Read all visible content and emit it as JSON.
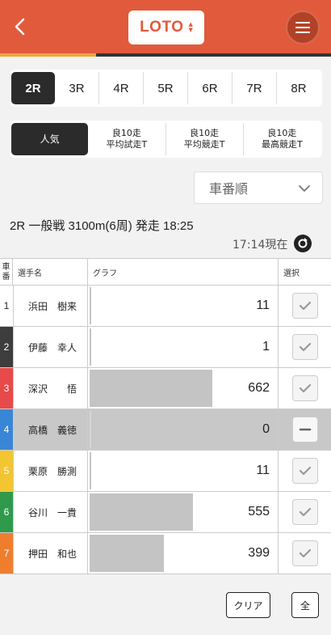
{
  "header": {
    "logo_label": "LOTO"
  },
  "colors": {
    "header": "#e15a3c",
    "accent": "#f2a23a",
    "active_tab": "#2b2b2b"
  },
  "race_tabs": [
    {
      "label": "2R",
      "active": true
    },
    {
      "label": "3R",
      "active": false
    },
    {
      "label": "4R",
      "active": false
    },
    {
      "label": "5R",
      "active": false
    },
    {
      "label": "6R",
      "active": false
    },
    {
      "label": "7R",
      "active": false
    },
    {
      "label": "8R",
      "active": false
    }
  ],
  "sort_tabs": [
    {
      "lines": [
        "人気"
      ],
      "active": true
    },
    {
      "lines": [
        "良10走",
        "平均試走T"
      ],
      "active": false
    },
    {
      "lines": [
        "良10走",
        "平均競走T"
      ],
      "active": false
    },
    {
      "lines": [
        "良10走",
        "最高競走T"
      ],
      "active": false
    }
  ],
  "order_select": {
    "value": "車番順"
  },
  "race_info": {
    "text": "2R 一般戦 3100m(6周) 発走 18:25",
    "current_time": "17:14現在"
  },
  "table": {
    "headers": {
      "number_line1": "車",
      "number_line2": "番",
      "name": "選手名",
      "graph": "グラフ",
      "select": "選択"
    },
    "max_count": 1000,
    "rows": [
      {
        "number": "1",
        "name": "浜田　樹来",
        "count": 11,
        "color": "#ffffff",
        "text_color": "#222222",
        "state": "check"
      },
      {
        "number": "2",
        "name": "伊藤　幸人",
        "count": 1,
        "color": "#3d3d3d",
        "text_color": "#ffffff",
        "state": "check"
      },
      {
        "number": "3",
        "name": "深沢　　悟",
        "count": 662,
        "color": "#e84a4a",
        "text_color": "#ffffff",
        "state": "check"
      },
      {
        "number": "4",
        "name": "高橋　義徳",
        "count": 0,
        "color": "#3a86d6",
        "text_color": "#ffffff",
        "state": "minus"
      },
      {
        "number": "5",
        "name": "栗原　勝測",
        "count": 11,
        "color": "#f3c530",
        "text_color": "#ffffff",
        "state": "check"
      },
      {
        "number": "6",
        "name": "谷川　一貴",
        "count": 555,
        "color": "#2f9a4c",
        "text_color": "#ffffff",
        "state": "check"
      },
      {
        "number": "7",
        "name": "押田　和也",
        "count": 399,
        "color": "#ef7d2e",
        "text_color": "#ffffff",
        "state": "check"
      }
    ]
  },
  "buttons": {
    "clear": "クリア",
    "all": "全"
  }
}
